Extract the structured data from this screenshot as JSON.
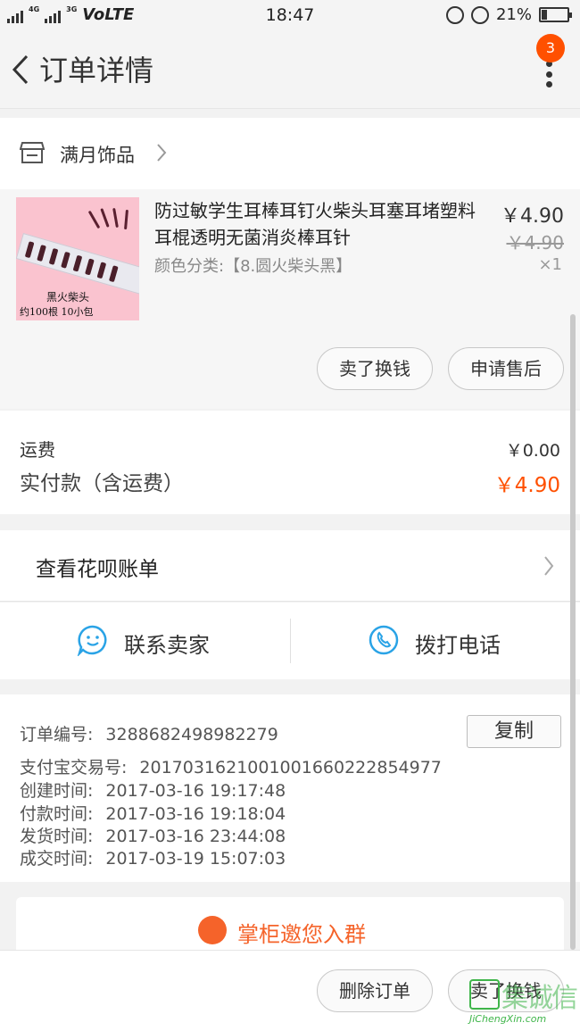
{
  "status_bar": {
    "network_a": "4G",
    "network_b": "3G",
    "carrier": "VoLTE",
    "time": "18:47",
    "battery": "21%"
  },
  "nav": {
    "title": "订单详情",
    "badge": "3"
  },
  "shop": {
    "name": "满月饰品"
  },
  "product": {
    "title": "防过敏学生耳棒耳钉火柴头耳塞耳堵塑料耳棍透明无菌消炎棒耳针",
    "sku": "颜色分类:【8.圆火柴头黑】",
    "price": "￥4.90",
    "original_price": "￥4.90",
    "quantity": "×1",
    "thumb_caption_1": "黑火柴头",
    "thumb_caption_2": "约100根  10小包",
    "actions": {
      "sell": "卖了换钱",
      "after_sale": "申请售后"
    }
  },
  "fees": {
    "shipping_label": "运费",
    "shipping_value": "￥0.00",
    "paid_label": "实付款（含运费）",
    "paid_value": "￥4.90"
  },
  "huabei": {
    "label": "查看花呗账单"
  },
  "contact": {
    "seller": "联系卖家",
    "phone": "拨打电话"
  },
  "order_info": {
    "order_no_label": "订单编号:",
    "order_no": "3288682498982279",
    "copy_label": "复制",
    "alipay_label": "支付宝交易号:",
    "alipay_no": "2017031621001001660222854977",
    "created_label": "创建时间:",
    "created": "2017-03-16 19:17:48",
    "paid_label": "付款时间:",
    "paid": "2017-03-16 19:18:04",
    "shipped_label": "发货时间:",
    "shipped": "2017-03-16 23:44:08",
    "done_label": "成交时间:",
    "done": "2017-03-19 15:07:03"
  },
  "group": {
    "label": "掌柜邀您入群"
  },
  "bottom": {
    "delete": "删除订单",
    "sell": "卖了换钱"
  },
  "watermark": {
    "text": "集诚信",
    "sub": "JiChengXin.com"
  },
  "colors": {
    "accent": "#ff5000",
    "group": "#f5632a",
    "contact_blue": "#2aa3e6"
  }
}
